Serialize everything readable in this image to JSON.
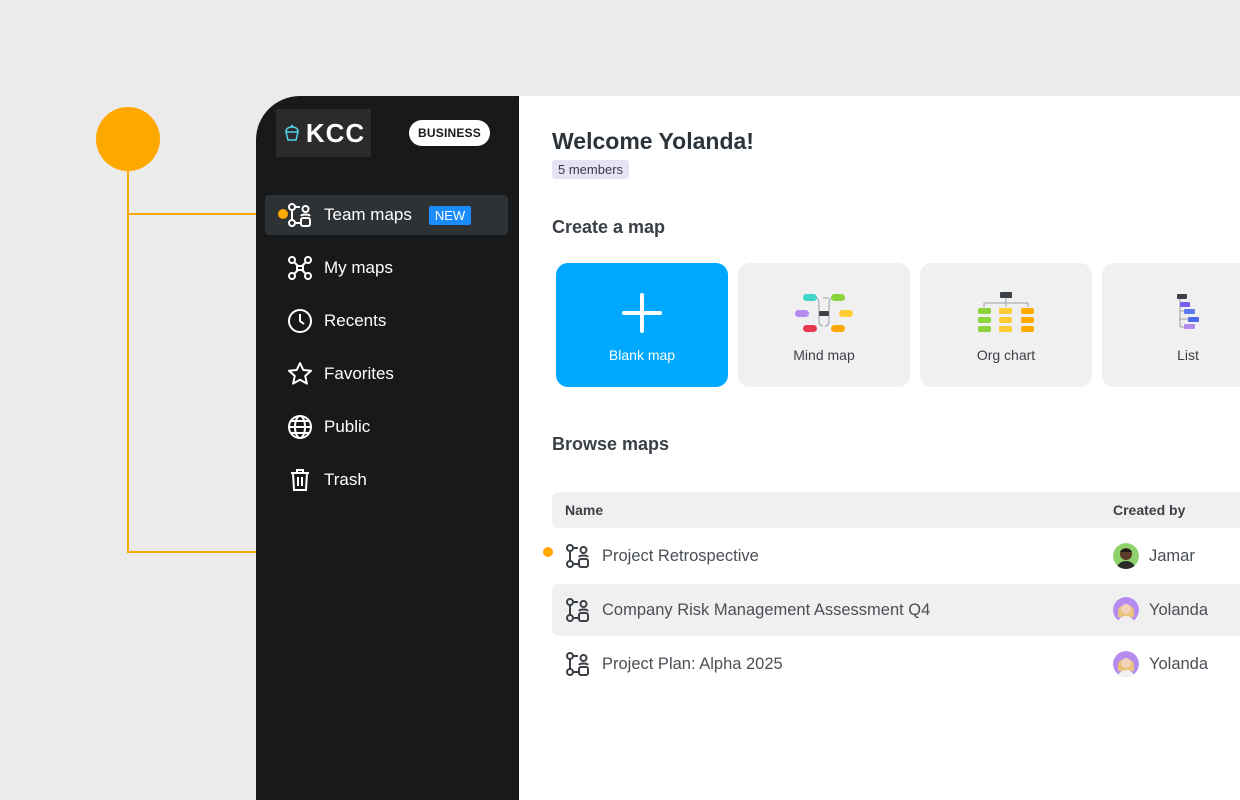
{
  "brand": {
    "logo_text": "KCC",
    "plan": "BUSINESS"
  },
  "sidebar": {
    "items": [
      {
        "label": "Team maps",
        "icon": "team-map-icon",
        "active": true,
        "tag": "NEW"
      },
      {
        "label": "My maps",
        "icon": "mind-map-icon"
      },
      {
        "label": "Recents",
        "icon": "clock-icon"
      },
      {
        "label": "Favorites",
        "icon": "star-icon"
      },
      {
        "label": "Public",
        "icon": "globe-icon"
      },
      {
        "label": "Trash",
        "icon": "trash-icon"
      }
    ]
  },
  "main": {
    "welcome": "Welcome Yolanda!",
    "members": "5 members",
    "create_title": "Create a map",
    "templates": [
      {
        "label": "Blank map",
        "icon": "plus-icon"
      },
      {
        "label": "Mind map",
        "icon": "mind-map-template-icon"
      },
      {
        "label": "Org chart",
        "icon": "org-chart-template-icon"
      },
      {
        "label": "List",
        "icon": "list-template-icon"
      }
    ],
    "browse_title": "Browse maps",
    "table": {
      "headers": {
        "name": "Name",
        "created_by": "Created by"
      },
      "rows": [
        {
          "name": "Project Retrospective",
          "created_by": "Jamar"
        },
        {
          "name": "Company Risk Management Assessment Q4",
          "created_by": "Yolanda"
        },
        {
          "name": "Project Plan: Alpha 2025",
          "created_by": "Yolanda"
        }
      ]
    }
  },
  "colors": {
    "accent": "#FFA800",
    "primary": "#00A8FF",
    "sidebar": "#17191B",
    "new_tag": "#1A8CFF"
  }
}
